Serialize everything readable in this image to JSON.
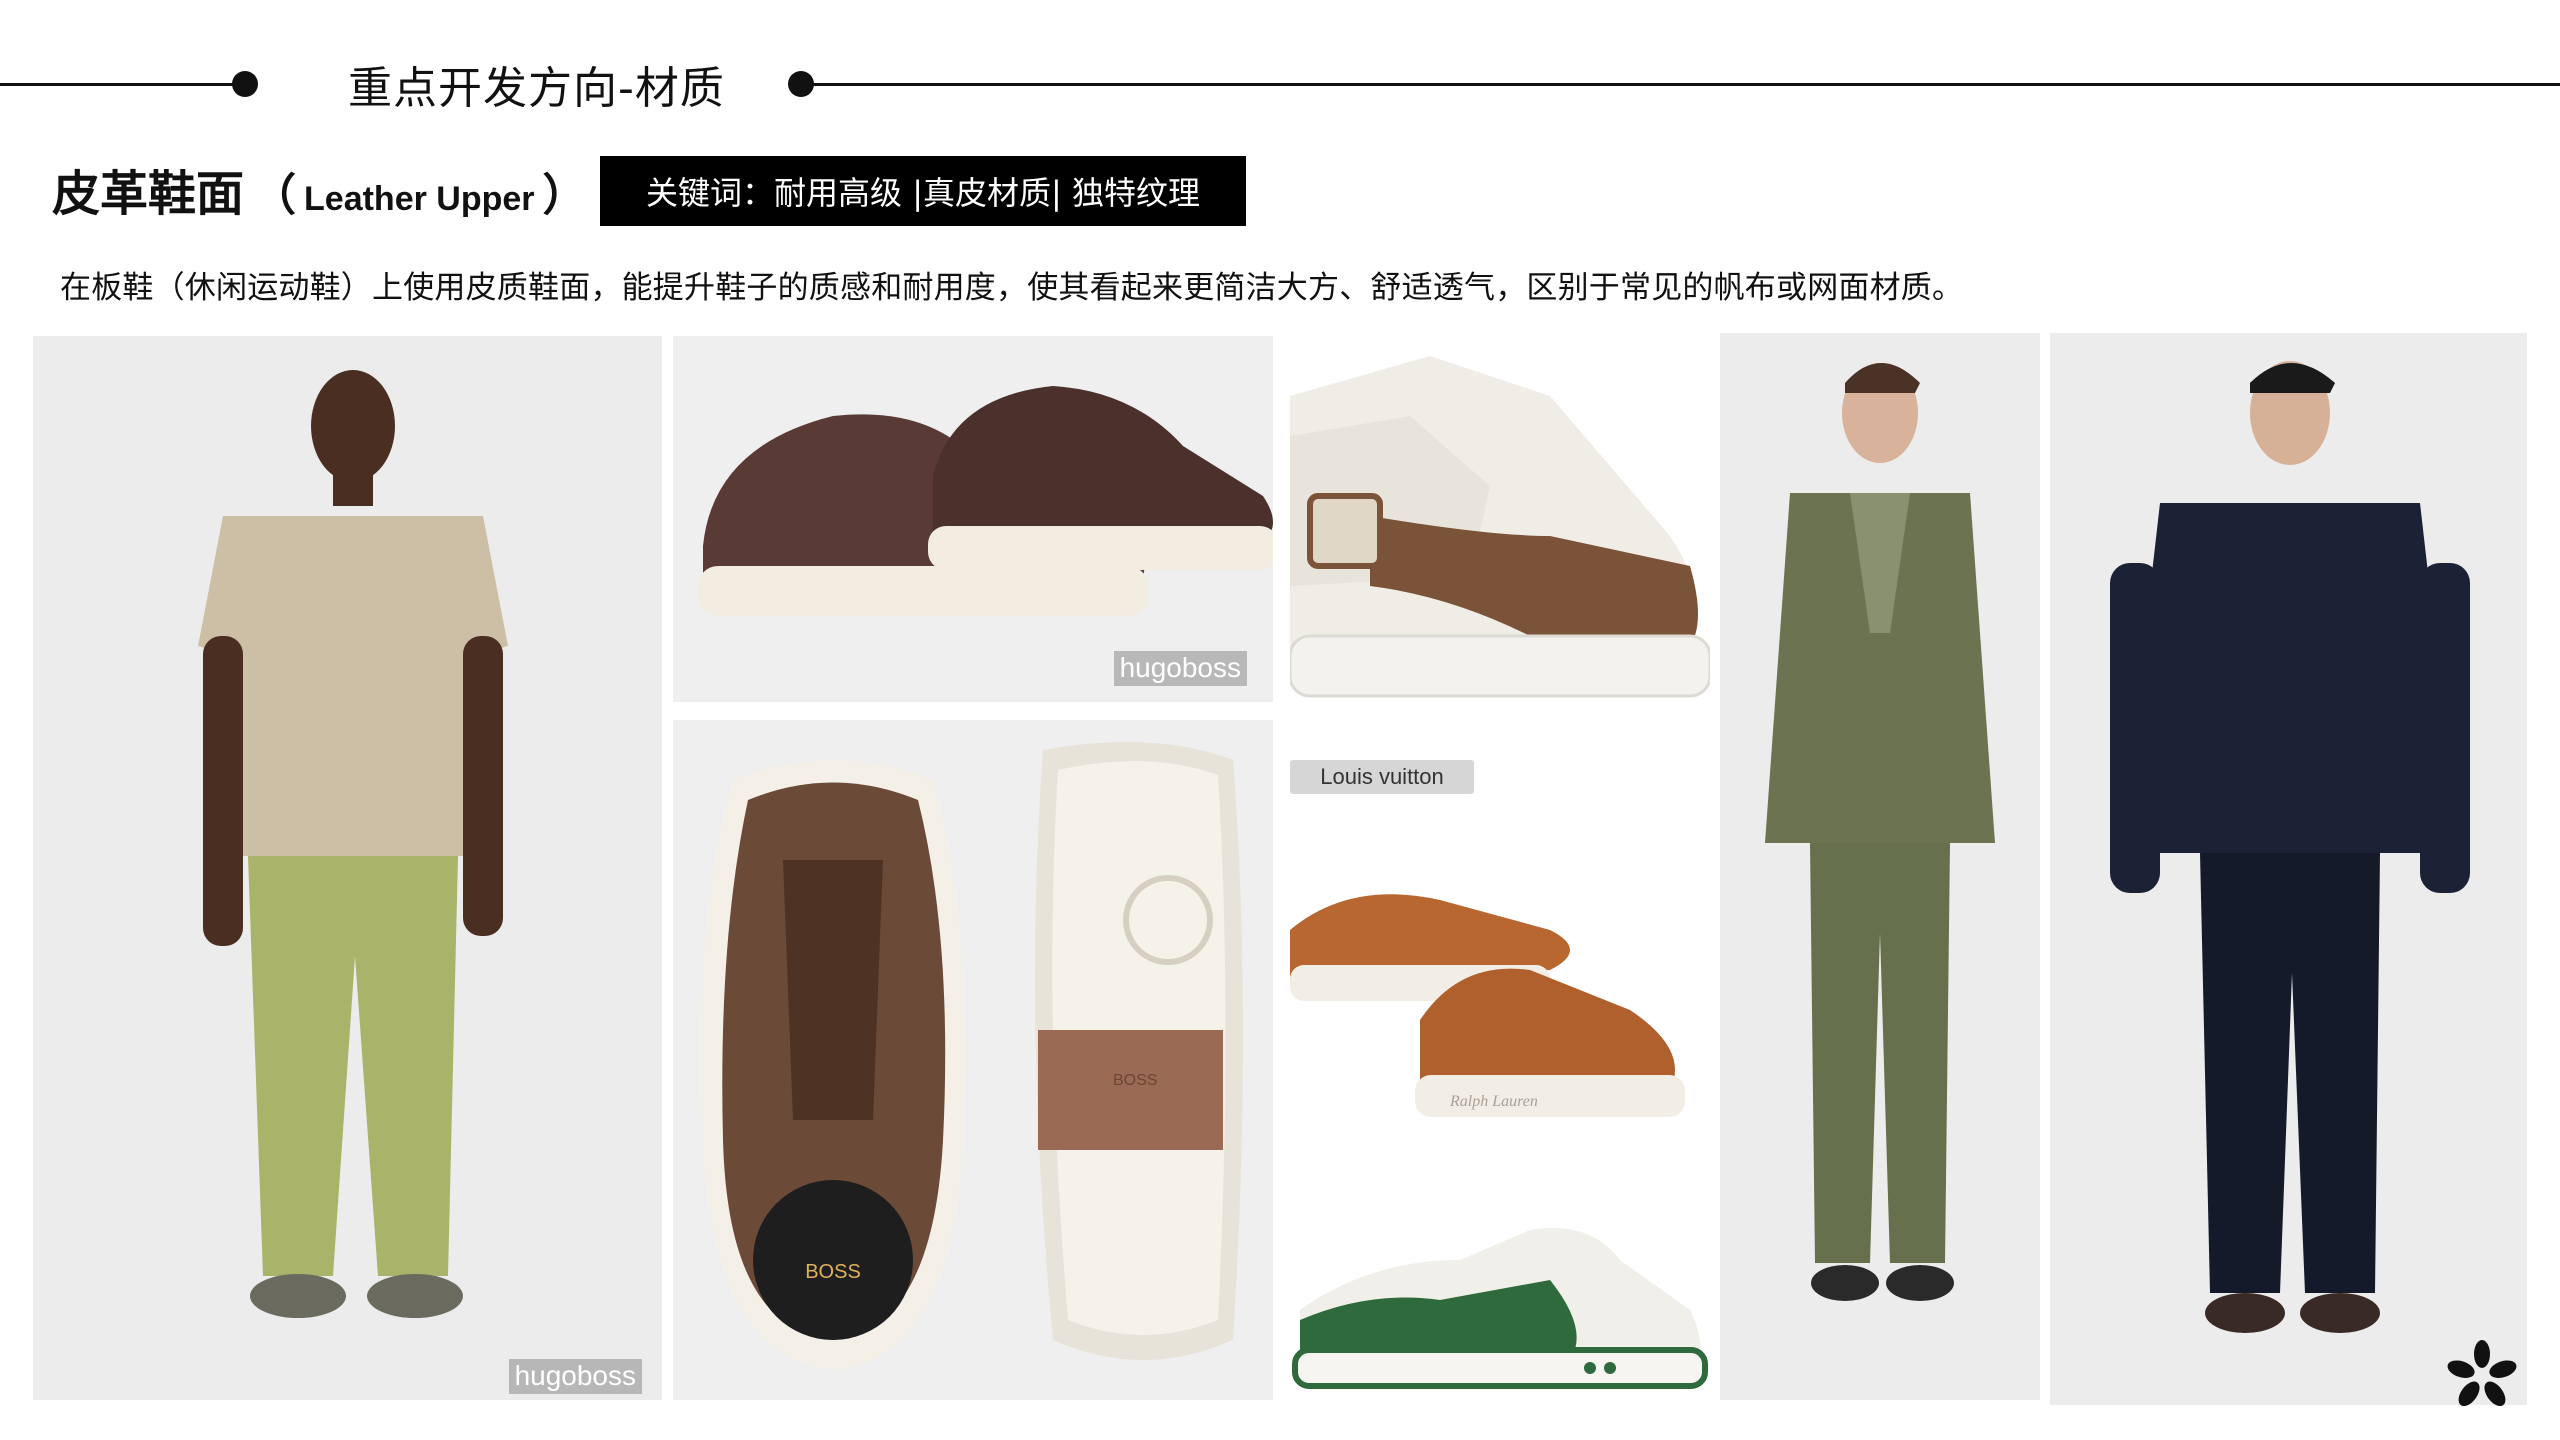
{
  "header": {
    "title": "重点开发方向-材质"
  },
  "section": {
    "title_zh": "皮革鞋面",
    "title_en": "Leather Upper",
    "paren_open": "（",
    "paren_close": "）"
  },
  "keywords": {
    "text": "关键词：耐用高级 |真皮材质| 独特纹理"
  },
  "description": "在板鞋（休闲运动鞋）上使用皮质鞋面，能提升鞋子的质感和耐用度，使其看起来更简洁大方、舒适透气，区别于常见的帆布或网面材质。",
  "images": {
    "watermark_hugoboss": "hugoboss",
    "tag_louis_vuitton": "Louis vuitton",
    "brand_boss": "BOSS",
    "brand_ralph": "Ralph Lauren"
  },
  "colors": {
    "accent": "#000000",
    "panel_bg": "#efefef",
    "green_pants": "#a9b36a",
    "olive_suit": "#6b7350",
    "navy_jacket": "#1b2236",
    "brown_leather": "#5a3a34",
    "suede_brown": "#6b4a37",
    "tan_leather": "#b7672f",
    "lv_green": "#2f6a3c"
  },
  "icons": {
    "logo": "sparkle-logo-icon"
  }
}
